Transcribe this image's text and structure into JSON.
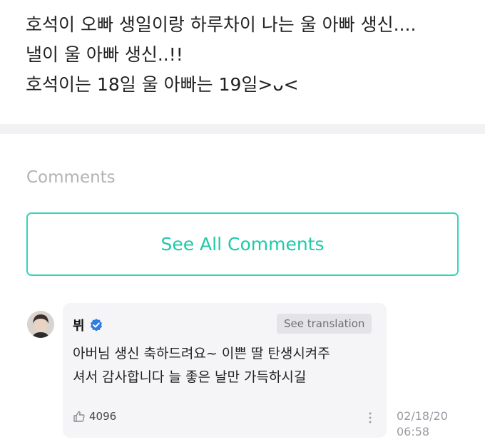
{
  "post": {
    "lines": [
      "호석이 오빠 생일이랑 하루차이 나는 울 아빠 생신....",
      "낼이 울 아빠 생신..!!",
      "호석이는 18일 울 아빠는 19일>ᴗ<"
    ]
  },
  "comments_section": {
    "heading": "Comments",
    "see_all_label": "See All Comments"
  },
  "comment": {
    "author": "뷔",
    "verified": true,
    "translate_label": "See translation",
    "text_lines": [
      "아버님 생신 축하드려요~ 이쁜 딸 탄생시켜주",
      "셔서 감사합니다 늘 좋은 날만 가득하시길"
    ],
    "like_count": "4096",
    "date": "02/18/20",
    "time": "06:58",
    "icons": {
      "verified": "verified-badge-icon",
      "like": "thumbs-up-icon",
      "more": "more-vertical-icon"
    }
  },
  "colors": {
    "accent": "#1fc9a8",
    "verified": "#2f7de1"
  }
}
